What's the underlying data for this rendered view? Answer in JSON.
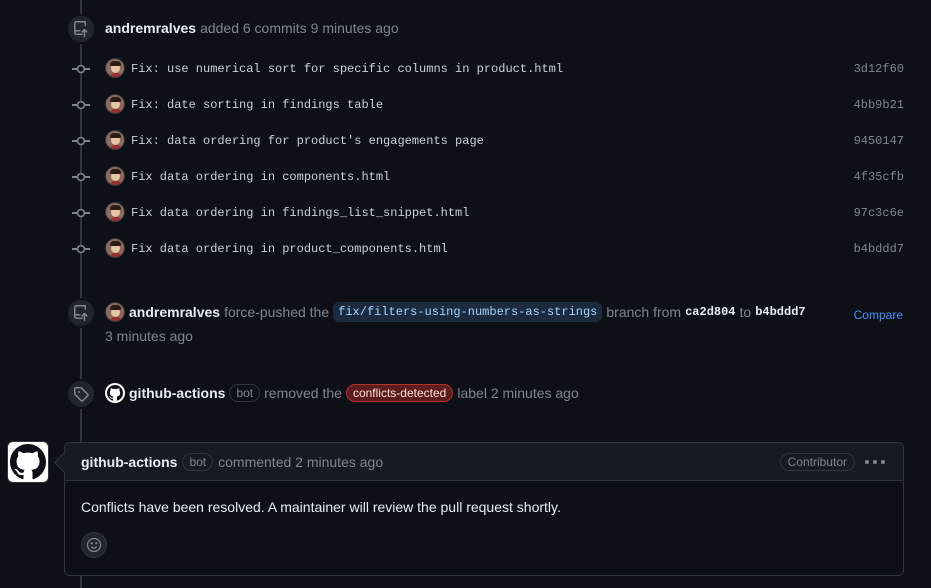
{
  "commits_event": {
    "author": "andremralves",
    "action": "added 6 commits",
    "time": "9 minutes ago"
  },
  "commits": [
    {
      "message": "Fix: use numerical sort for specific columns in product.html",
      "sha": "3d12f60"
    },
    {
      "message": "Fix: date sorting in findings table",
      "sha": "4bb9b21"
    },
    {
      "message": "Fix: data ordering for product's engagements page",
      "sha": "9450147"
    },
    {
      "message": "Fix data ordering in components.html",
      "sha": "4f35cfb"
    },
    {
      "message": "Fix data ordering in findings_list_snippet.html",
      "sha": "97c3c6e"
    },
    {
      "message": "Fix data ordering in product_components.html",
      "sha": "b4bddd7"
    }
  ],
  "force_push_event": {
    "author": "andremralves",
    "action": "force-pushed the",
    "branch": "fix/filters-using-numbers-as-strings",
    "branch_word": "branch from",
    "from_sha": "ca2d804",
    "to_word": "to",
    "to_sha": "b4bddd7",
    "time": "3 minutes ago",
    "compare_label": "Compare"
  },
  "label_event": {
    "author": "github-actions",
    "bot_badge": "bot",
    "action": "removed the",
    "label": "conflicts-detected",
    "suffix": "label 2 minutes ago"
  },
  "comment": {
    "author": "github-actions",
    "bot_badge": "bot",
    "meta": "commented 2 minutes ago",
    "role_badge": "Contributor",
    "body": "Conflicts have been resolved. A maintainer will review the pull request shortly."
  },
  "colors": {
    "background": "#0d1117",
    "link": "#4493f8",
    "label_border": "#b3302b"
  },
  "icons": {
    "commits_event": "repo-push-icon",
    "commit": "git-commit-icon",
    "force_push": "repo-push-icon",
    "label": "tag-icon",
    "avatar": "github-mark-icon",
    "menu": "kebab-horizontal-icon",
    "reaction": "smiley-icon"
  }
}
